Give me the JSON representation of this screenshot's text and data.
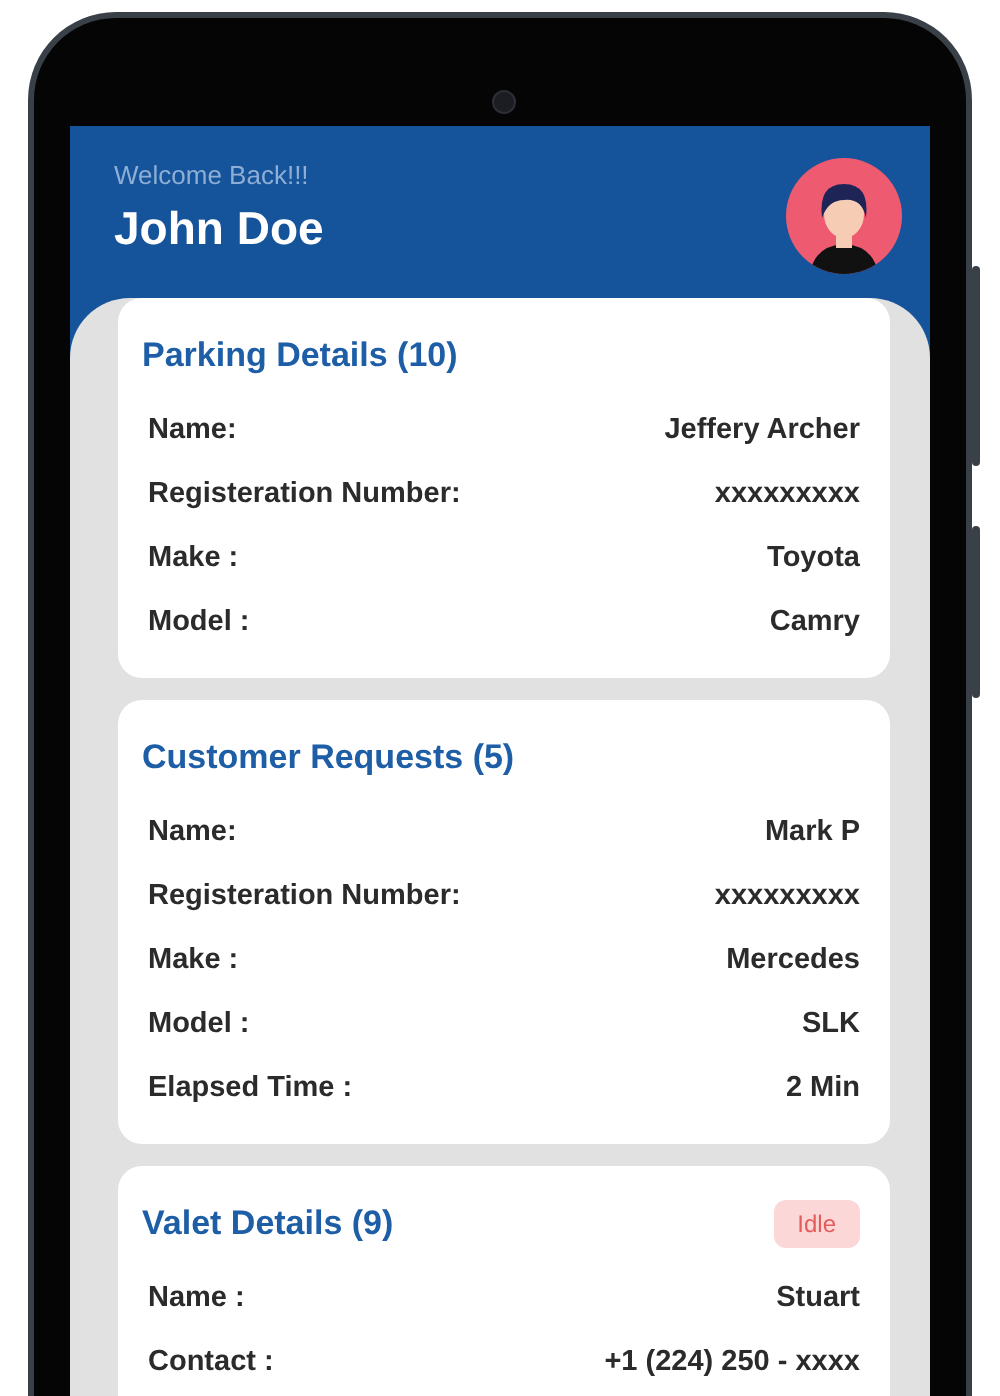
{
  "header": {
    "greeting": "Welcome Back!!!",
    "user_name": "John Doe"
  },
  "cards": [
    {
      "title": "Parking Details (10)",
      "rows": [
        {
          "label": "Name:",
          "value": "Jeffery Archer"
        },
        {
          "label": "Registeration Number:",
          "value": "xxxxxxxxx"
        },
        {
          "label": "Make :",
          "value": "Toyota"
        },
        {
          "label": "Model :",
          "value": "Camry"
        }
      ]
    },
    {
      "title": "Customer Requests (5)",
      "rows": [
        {
          "label": "Name:",
          "value": "Mark P"
        },
        {
          "label": "Registeration Number:",
          "value": "xxxxxxxxx"
        },
        {
          "label": "Make :",
          "value": "Mercedes"
        },
        {
          "label": "Model :",
          "value": "SLK"
        },
        {
          "label": "Elapsed Time :",
          "value": "2 Min"
        }
      ]
    },
    {
      "title": "Valet Details (9)",
      "badge": "Idle",
      "rows": [
        {
          "label": "Name :",
          "value": "Stuart"
        },
        {
          "label": "Contact :",
          "value": "+1 (224) 250 - xxxx"
        }
      ]
    }
  ]
}
